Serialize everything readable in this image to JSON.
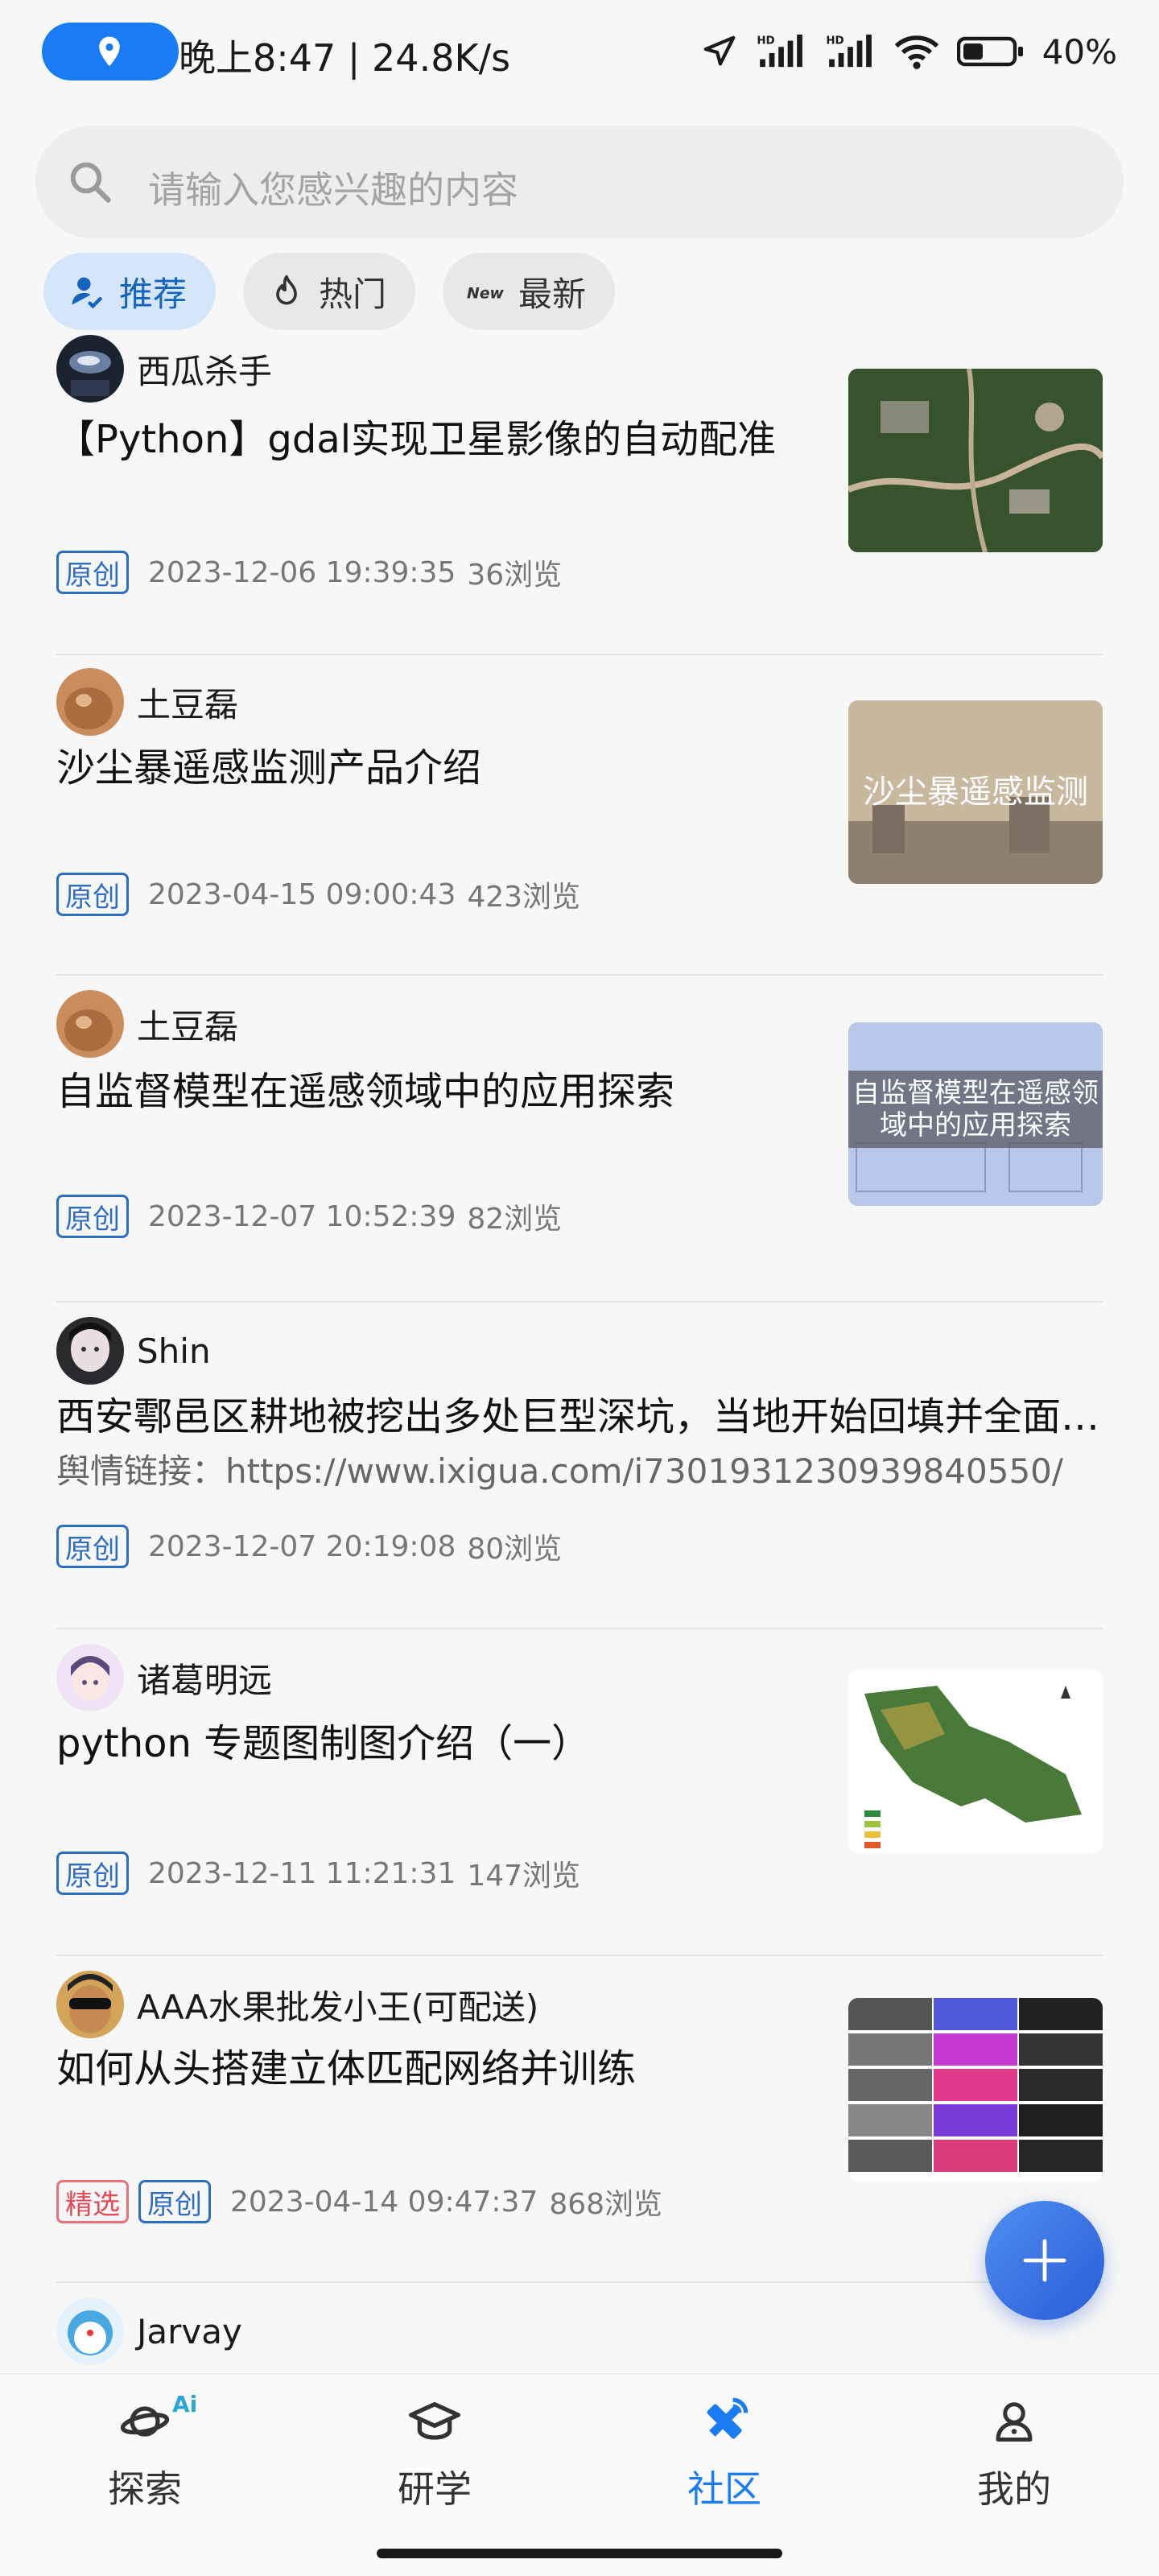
{
  "status_bar": {
    "time_speed": "晚上8:47 | 24.8K/s",
    "battery": "40%"
  },
  "search": {
    "placeholder": "请输入您感兴趣的内容"
  },
  "tabs": [
    {
      "label": "推荐",
      "icon": "user-recommend-icon",
      "active": true
    },
    {
      "label": "热门",
      "icon": "flame-icon",
      "active": false
    },
    {
      "label": "最新",
      "icon": "new-badge-icon",
      "active": false
    }
  ],
  "posts": [
    {
      "author": "西瓜杀手",
      "title": "【Python】gdal实现卫星影像的自动配准",
      "badges": [
        "原创"
      ],
      "date": "2023-12-06 19:39:35",
      "views": "36浏览"
    },
    {
      "author": "土豆磊",
      "title": "沙尘暴遥感监测产品介绍",
      "badges": [
        "原创"
      ],
      "date": "2023-04-15 09:00:43",
      "views": "423浏览",
      "thumb_caption": "沙尘暴遥感监测"
    },
    {
      "author": "土豆磊",
      "title": "自监督模型在遥感领域中的应用探索",
      "badges": [
        "原创"
      ],
      "date": "2023-12-07 10:52:39",
      "views": "82浏览",
      "thumb_caption": "自监督模型在遥感领域中的应用探索"
    },
    {
      "author": "Shin",
      "title": "西安鄠邑区耕地被挖出多处巨型深坑，当地开始回填并全面整改",
      "excerpt": "舆情链接：https://www.ixigua.com/i7301931230939840550/",
      "badges": [
        "原创"
      ],
      "date": "2023-12-07 20:19:08",
      "views": "80浏览"
    },
    {
      "author": "诸葛明远",
      "title": "python 专题图制图介绍（一）",
      "badges": [
        "原创"
      ],
      "date": "2023-12-11 11:21:31",
      "views": "147浏览"
    },
    {
      "author": "AAA水果批发小王(可配送)",
      "title": "如何从头搭建立体匹配网络并训练",
      "badges": [
        "精选",
        "原创"
      ],
      "date": "2023-04-14 09:47:37",
      "views": "868浏览"
    },
    {
      "author": "Jarvay"
    }
  ],
  "bottom_nav": [
    {
      "label": "探索",
      "icon": "planet-icon",
      "badge": "Ai",
      "active": false
    },
    {
      "label": "研学",
      "icon": "graduation-cap-icon",
      "active": false
    },
    {
      "label": "社区",
      "icon": "satellite-icon",
      "active": true
    },
    {
      "label": "我的",
      "icon": "user-icon",
      "active": false
    }
  ],
  "colors": {
    "accent": "#1a7cf5",
    "badge_blue": "#2b6cc4",
    "badge_red": "#e34a55"
  }
}
